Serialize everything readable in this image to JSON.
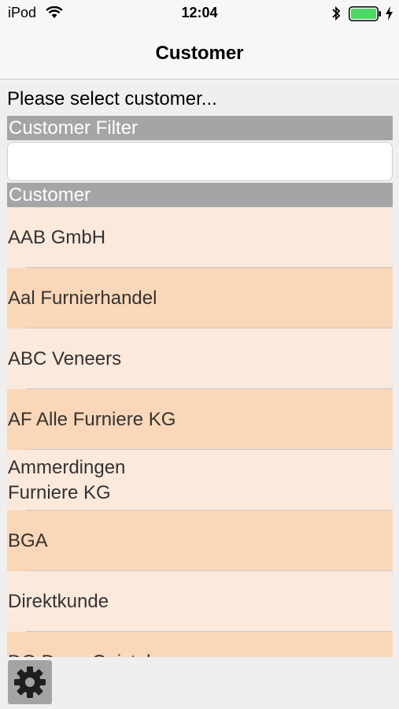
{
  "status_bar": {
    "carrier": "iPod",
    "time": "12:04",
    "icons": [
      "wifi-icon",
      "bluetooth-icon",
      "battery-icon",
      "charging-icon"
    ],
    "battery_color": "#4cd964"
  },
  "nav": {
    "title": "Customer"
  },
  "prompt": "Please select customer...",
  "filter": {
    "header": "Customer Filter",
    "value": "",
    "placeholder": ""
  },
  "customers": {
    "header": "Customer",
    "items": [
      {
        "label": "AAB GmbH"
      },
      {
        "label": "Aal Furnierhandel"
      },
      {
        "label": "ABC Veneers"
      },
      {
        "label": "AF Alle Furniere KG"
      },
      {
        "label": "Ammerdingen\nFurniere KG"
      },
      {
        "label": "BGA"
      },
      {
        "label": "Direktkunde"
      },
      {
        "label": "DG Dona Gnistel"
      }
    ]
  },
  "colors": {
    "row_light": "#fbe9dc",
    "row_dark": "#fad7b8",
    "section_header": "#a5a5a5"
  },
  "toolbar": {
    "settings_icon": "gear-icon"
  }
}
